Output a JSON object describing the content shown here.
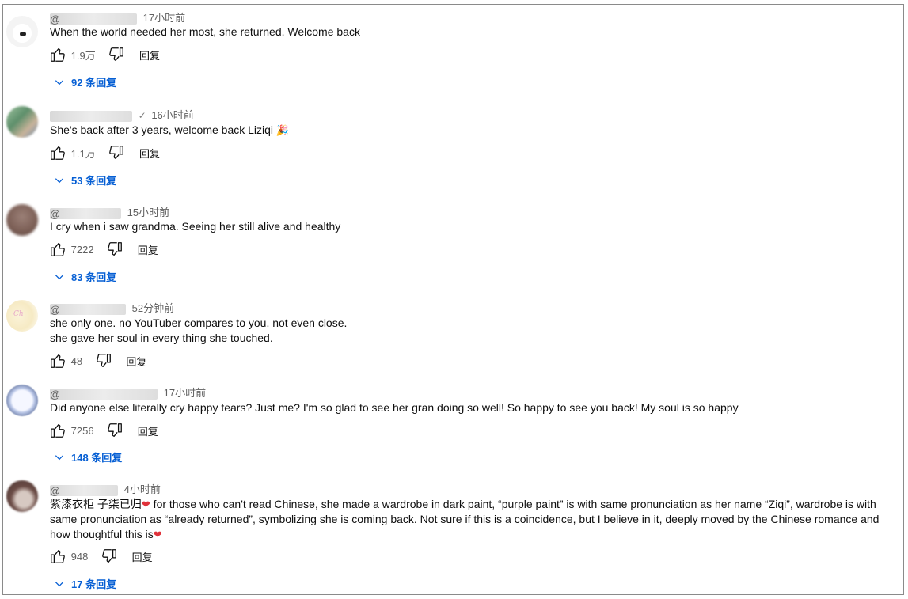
{
  "comments": [
    {
      "handle": "@",
      "verified": "",
      "time": "17小时前",
      "lines": [
        "When the world needed her most, she returned. Welcome back"
      ],
      "likes": "1.9万",
      "reply_label": "回复",
      "replies": "92 条回复"
    },
    {
      "handle": "",
      "verified": "✓",
      "time": "16小时前",
      "lines": [
        "She's back after 3 years, welcome back Liziqi"
      ],
      "emoji": "🎉",
      "likes": "1.1万",
      "reply_label": "回复",
      "replies": "53 条回复"
    },
    {
      "handle": "@",
      "verified": "",
      "time": "15小时前",
      "lines": [
        "I cry when i saw grandma. Seeing her still alive and healthy"
      ],
      "likes": "7222",
      "reply_label": "回复",
      "replies": "83 条回复"
    },
    {
      "handle": "@",
      "verified": "",
      "time": "52分钟前",
      "lines": [
        "she only one. no YouTuber compares to you. not even close.",
        "she gave her soul in every thing she touched."
      ],
      "likes": "48",
      "reply_label": "回复"
    },
    {
      "handle": "@",
      "verified": "",
      "time": "17小时前",
      "lines": [
        "Did anyone else literally cry happy tears? Just me? I'm so glad to see her gran doing so well! So happy to see you back! My soul is so happy"
      ],
      "likes": "7256",
      "reply_label": "回复",
      "replies": "148 条回复"
    },
    {
      "handle": "@",
      "verified": "",
      "time": "4小时前",
      "prefix": "紫漆衣柜 子柒已归",
      "heart": "❤",
      "body": " for those who can't read Chinese, she made a wardrobe in dark paint, “purple paint” is with same pronunciation as her name “Ziqi”, wardrobe is with same pronunciation as “already returned”, symbolizing she is coming back. Not sure if this is a coincidence, but I believe in it, deeply moved by the Chinese romance and how thoughtful this is",
      "likes": "948",
      "reply_label": "回复",
      "replies": "17 条回复"
    }
  ],
  "colors": {
    "link": "#065fd4",
    "meta": "#606060",
    "heart": "#e0323a"
  }
}
